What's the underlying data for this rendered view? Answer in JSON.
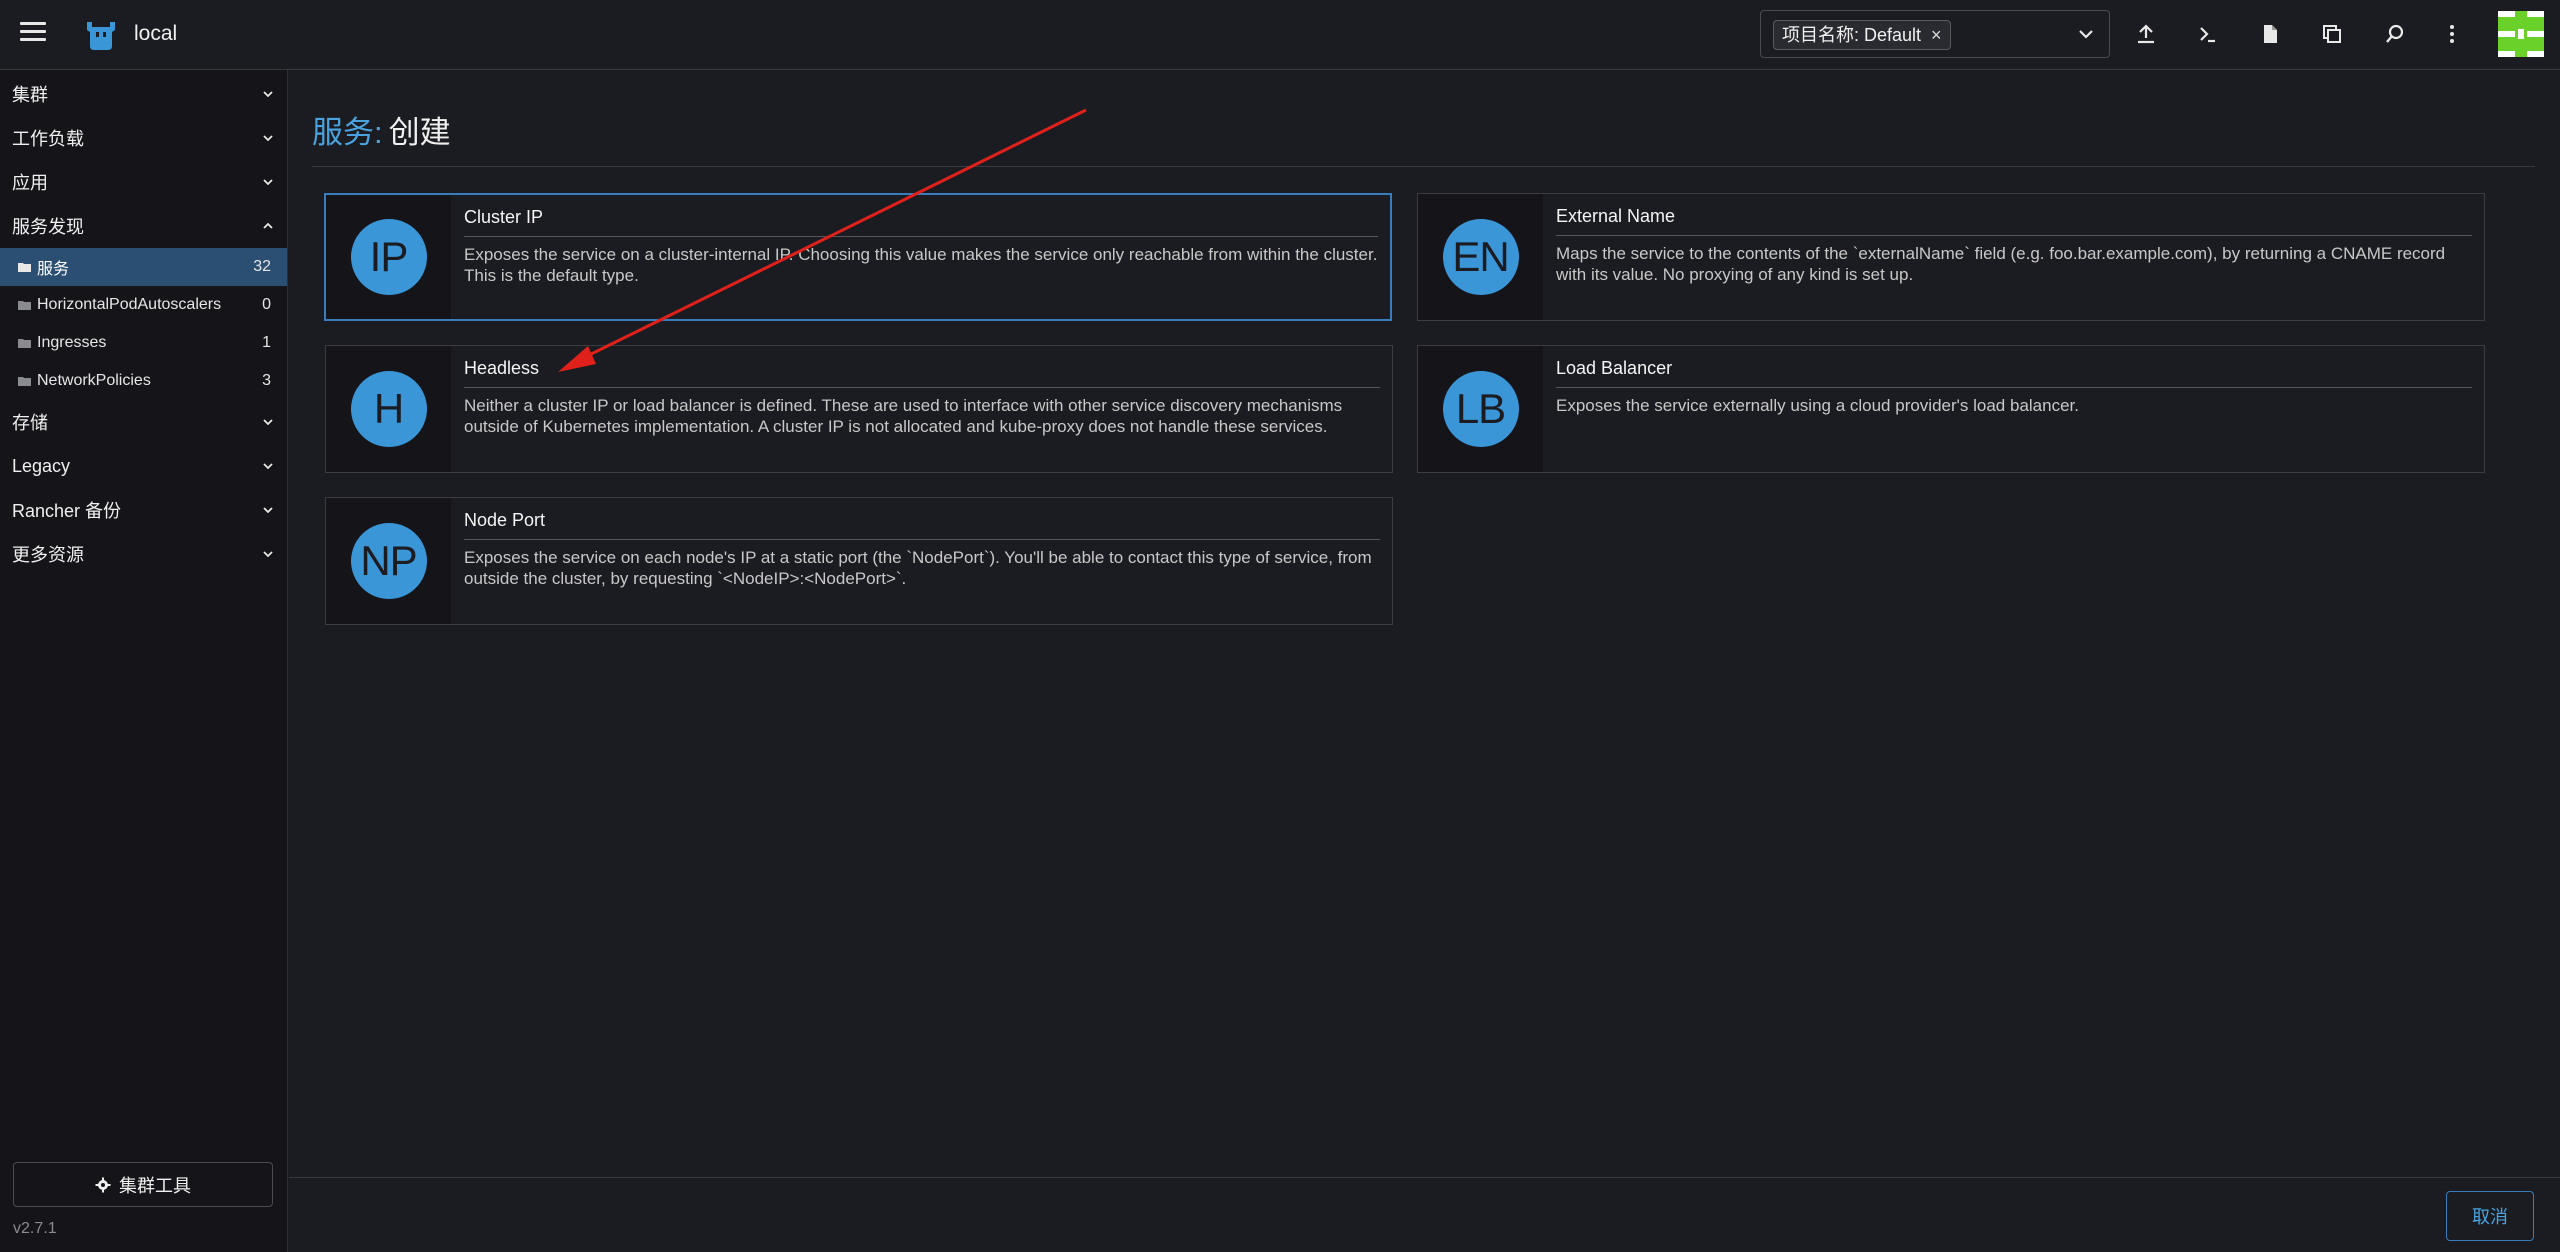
{
  "header": {
    "cluster_name": "local",
    "namespace_chip": "项目名称: Default",
    "chip_close": "×"
  },
  "sidebar": {
    "groups": [
      {
        "label": "集群",
        "state": "collapsed"
      },
      {
        "label": "工作负载",
        "state": "collapsed"
      },
      {
        "label": "应用",
        "state": "collapsed"
      },
      {
        "label": "服务发现",
        "state": "expanded"
      },
      {
        "label": "存储",
        "state": "collapsed"
      },
      {
        "label": "Legacy",
        "state": "collapsed"
      },
      {
        "label": "Rancher 备份",
        "state": "collapsed"
      },
      {
        "label": "更多资源",
        "state": "collapsed"
      }
    ],
    "items": [
      {
        "label": "服务",
        "count": "32"
      },
      {
        "label": "HorizontalPodAutoscalers",
        "count": "0"
      },
      {
        "label": "Ingresses",
        "count": "1"
      },
      {
        "label": "NetworkPolicies",
        "count": "3"
      }
    ],
    "cluster_tools": "集群工具",
    "version": "v2.7.1"
  },
  "main": {
    "title_prefix": "服务:",
    "title_suffix": "创建",
    "cards": [
      {
        "abbr": "IP",
        "title": "Cluster IP",
        "desc": "Exposes the service on a cluster-internal IP. Choosing this value makes the service only reachable from within the cluster. This is the default type."
      },
      {
        "abbr": "EN",
        "title": "External Name",
        "desc": "Maps the service to the contents of the `externalName` field (e.g. foo.bar.example.com), by returning a CNAME record with its value. No proxying of any kind is set up."
      },
      {
        "abbr": "H",
        "title": "Headless",
        "desc": "Neither a cluster IP or load balancer is defined. These are used to interface with other service discovery mechanisms outside of Kubernetes implementation. A cluster IP is not allocated and kube-proxy does not handle these services."
      },
      {
        "abbr": "LB",
        "title": "Load Balancer",
        "desc": "Exposes the service externally using a cloud provider's load balancer."
      },
      {
        "abbr": "NP",
        "title": "Node Port",
        "desc": "Exposes the service on each node's IP at a static port (the `NodePort`). You'll be able to contact this type of service, from outside the cluster, by requesting `<NodeIP>:<NodePort>`."
      }
    ],
    "cancel_label": "取消"
  },
  "colors": {
    "accent": "#3b96d8",
    "background": "#1b1c21",
    "sidebar": "#141419",
    "active_item": "#2b4f72",
    "annotation_arrow": "#e0201a"
  },
  "icons": [
    "hamburger-icon",
    "rancher-cluster-icon",
    "chevron-down-icon",
    "upload-icon",
    "shell-icon",
    "file-icon",
    "copy-config-icon",
    "search-icon",
    "more-vertical-icon",
    "folder-icon",
    "gear-icon"
  ]
}
